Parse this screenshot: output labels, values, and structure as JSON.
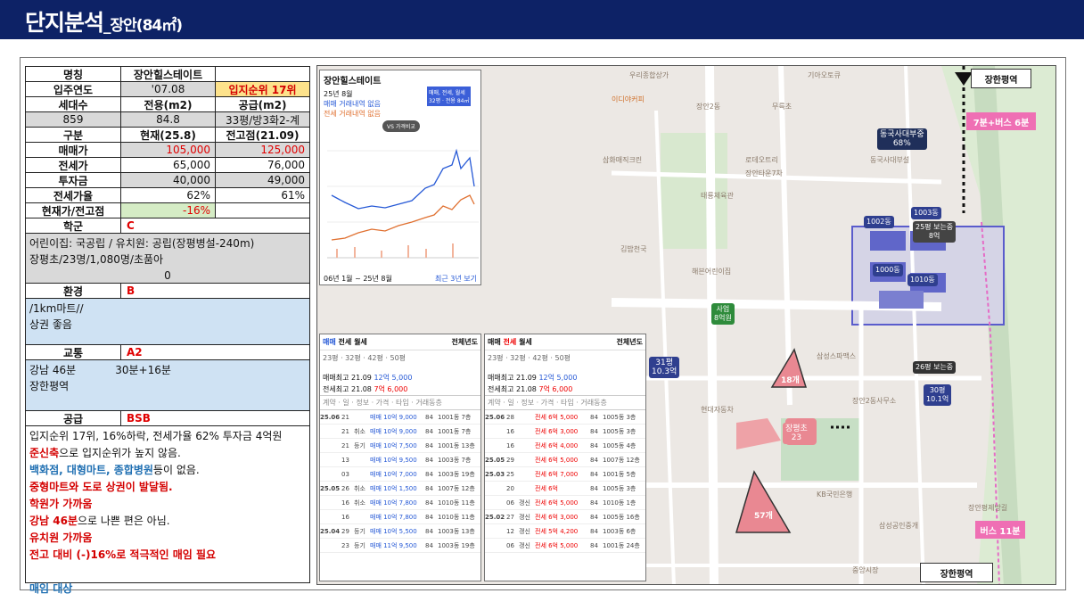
{
  "header": {
    "title": "단지분석",
    "subtitle": "_장안(84㎡)"
  },
  "summary": {
    "name_label": "명칭",
    "name": "장안힐스테이트",
    "year_label": "입주연도",
    "year": "'07.08",
    "rank": "입지순위 17위",
    "households_label": "세대수",
    "exclusive_label": "전용(m2)",
    "supply_label": "공급(m2)",
    "households": "859",
    "exclusive": "84.8",
    "supply": "33평/방3화2-계",
    "div_label": "구분",
    "current_label": "현재(25.8)",
    "peak_label": "전고점(21.09)",
    "rows": [
      {
        "label": "매매가",
        "current": "105,000",
        "peak": "125,000"
      },
      {
        "label": "전세가",
        "current": "65,000",
        "peak": "76,000"
      },
      {
        "label": "투자금",
        "current": "40,000",
        "peak": "49,000"
      },
      {
        "label": "전세가율",
        "current": "62%",
        "peak": "61%"
      },
      {
        "label": "현재가/전고점",
        "current": "-16%",
        "peak": ""
      }
    ]
  },
  "school": {
    "label": "학군",
    "grade": "C",
    "text1": "어린이집: 국공립 / 유치원: 공립(장평병설-240m)",
    "text2": "장평초/23명/1,080명/초품아",
    "text3": "0"
  },
  "env": {
    "label": "환경",
    "grade": "B",
    "text1": "/1km마트//",
    "text2": "상권 좋음"
  },
  "traffic": {
    "label": "교통",
    "grade": "A2",
    "text1": "강남 46분",
    "text1b": "30분+16분",
    "text2": "장한평역"
  },
  "supply": {
    "label": "공급",
    "grade": "BSB",
    "lines": [
      {
        "t": "입지순위 17위, 16%하락, 전세가율 62% 투자금 4억원",
        "c": "#111"
      },
      {
        "t": "준신축으로 입지순위가 높지 않음.",
        "c": "#111",
        "hl": "준신축",
        "hc": "#d40000"
      },
      {
        "t": "백화점, 대형마트, 종합병원등이 없음.",
        "c": "#111",
        "hl": "백화점, 대형마트, 종합병원",
        "hc": "#1f6fb2"
      },
      {
        "t": "중형마트와 도로 상권이 발달됨.",
        "c": "#d40000"
      },
      {
        "t": "학원가 가까움",
        "c": "#d40000"
      },
      {
        "t": "강남 46분으로 나쁜 편은 아님.",
        "c": "#111",
        "hl": "강남 46분",
        "hc": "#d40000"
      },
      {
        "t": "유치원 가까움",
        "c": "#d40000"
      },
      {
        "t": "전고 대비 (-)16%로 적극적인 매임 필요",
        "c": "#d40000"
      },
      {
        "t": "",
        "c": "#111"
      },
      {
        "t": "매임 대상",
        "c": "#1f6fb2"
      }
    ]
  },
  "map": {
    "chart_panel": {
      "title": "장안힐스테이트",
      "date": "25년 8월",
      "l1": "매매 거래내역 없음",
      "l2": "전세 거래내역 없음",
      "vs": "VS 가격비교",
      "filter": "매매, 전세, 월세",
      "filter2": "32평 · 전용 84㎡",
      "range": "06년 1월 ~ 25년 8월",
      "recent": "최근 3년 보기"
    },
    "trade1": {
      "tabs": [
        "매매",
        "전세",
        "월세"
      ],
      "filter": "전체년도",
      "max1": "매매최고 21.09",
      "max1v": "12억 5,000",
      "max2": "전세최고 21.08",
      "max2v": "7억 6,000",
      "rows": [
        [
          "25.06",
          "21",
          "",
          "매매 10억 9,000",
          "84",
          "1001동 7층"
        ],
        [
          "",
          "21",
          "취소",
          "매매 10억 9,000",
          "84",
          "1001동 7층"
        ],
        [
          "",
          "21",
          "등기",
          "매매 10억 7,500",
          "84",
          "1001동 13층"
        ],
        [
          "",
          "13",
          "",
          "매매 10억 9,500",
          "84",
          "1003동 7층"
        ],
        [
          "",
          "03",
          "",
          "매매 10억 7,000",
          "84",
          "1003동 19층"
        ],
        [
          "25.05",
          "26",
          "취소",
          "매매 10억 1,500",
          "84",
          "1007동 12층"
        ],
        [
          "",
          "16",
          "취소",
          "매매 10억 7,800",
          "84",
          "1010동 11층"
        ],
        [
          "",
          "16",
          "",
          "매매 10억 7,800",
          "84",
          "1010동 11층"
        ],
        [
          "25.04",
          "29",
          "등기",
          "매매 10억 5,500",
          "84",
          "1003동 13층"
        ],
        [
          "",
          "23",
          "등기",
          "매매 11억 9,500",
          "84",
          "1003동 19층"
        ]
      ]
    },
    "trade2": {
      "tabs": [
        "매매",
        "전세",
        "월세"
      ],
      "filter": "전체년도",
      "max1": "매매최고 21.09",
      "max1v": "12억 5,000",
      "max2": "전세최고 21.08",
      "max2v": "7억 6,000",
      "rows": [
        [
          "25.06",
          "28",
          "",
          "전세 6억 5,000",
          "84",
          "1005동 3층"
        ],
        [
          "",
          "16",
          "",
          "전세 6억 3,000",
          "84",
          "1005동 3층"
        ],
        [
          "",
          "16",
          "",
          "전세 6억 4,000",
          "84",
          "1005동 4층"
        ],
        [
          "25.05",
          "29",
          "",
          "전세 6억 5,000",
          "84",
          "1007동 12층"
        ],
        [
          "25.03",
          "25",
          "",
          "전세 6억 7,000",
          "84",
          "1001동 5층"
        ],
        [
          "",
          "20",
          "",
          "전세 6억",
          "84",
          "1005동 3층"
        ],
        [
          "",
          "06",
          "갱신",
          "전세 6억 5,000",
          "84",
          "1010동 1층"
        ],
        [
          "25.02",
          "27",
          "갱신",
          "전세 6억 3,000",
          "84",
          "1005동 16층"
        ],
        [
          "",
          "12",
          "갱신",
          "전세 5억 4,200",
          "84",
          "1003동 6층"
        ],
        [
          "",
          "06",
          "갱신",
          "전세 6억 5,000",
          "84",
          "1001동 24층"
        ]
      ]
    },
    "labels": {
      "station_top": "장한평역",
      "station_bottom": "장한평역",
      "walk": "7분+버스 6분",
      "bus": "버스 11분",
      "school_name": "장평초",
      "school_num": "23",
      "uni": "동국사대부중",
      "uni_num": "68%",
      "p1002": "1002동",
      "p1003": "1003동",
      "p1000": "1000동",
      "p1010": "1010동",
      "a78": "78A",
      "brief1": "25평 보는중",
      "price1": "8억",
      "brief2": "26평 보는중",
      "price2": "30평",
      "price2b": "10.1억",
      "left": "31평",
      "leftv": "10.3억",
      "tri1": "18개",
      "tri2": "57개",
      "green": "사업",
      "greenv": "8억원"
    }
  }
}
